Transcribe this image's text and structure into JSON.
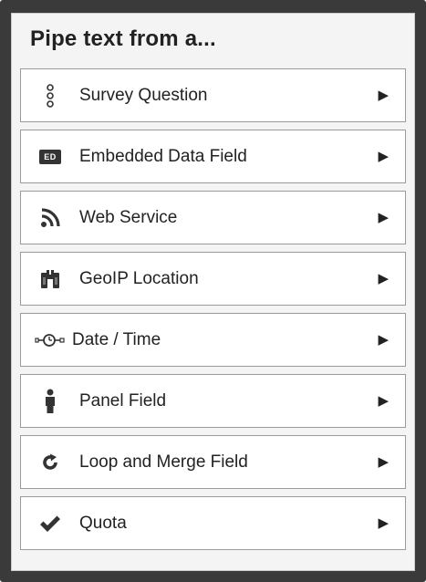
{
  "panel": {
    "title": "Pipe text from a..."
  },
  "menu": {
    "arrow_glyph": "▶",
    "items": [
      {
        "label": "Survey Question",
        "icon": "question-dots-icon"
      },
      {
        "label": "Embedded Data Field",
        "icon": "embedded-data-icon",
        "icon_text": "ED"
      },
      {
        "label": "Web Service",
        "icon": "rss-feed-icon"
      },
      {
        "label": "GeoIP Location",
        "icon": "binoculars-icon"
      },
      {
        "label": "Date / Time",
        "icon": "clock-icon"
      },
      {
        "label": "Panel Field",
        "icon": "person-icon"
      },
      {
        "label": "Loop and Merge Field",
        "icon": "loop-icon"
      },
      {
        "label": "Quota",
        "icon": "checkmark-icon"
      }
    ]
  },
  "colors": {
    "frame": "#3a3a3a",
    "panel_bg": "#f4f4f4",
    "item_bg": "#ffffff",
    "item_border": "#9a9a9a",
    "text": "#222222",
    "icon": "#333333"
  }
}
